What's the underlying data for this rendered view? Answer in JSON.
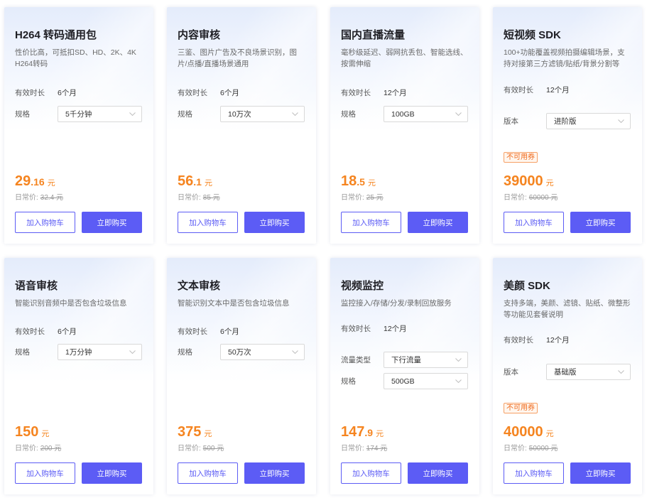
{
  "colors": {
    "accent": "#5c5cf5",
    "price": "#f5841f",
    "badge_text": "#f06a1c",
    "badge_border": "#f6a066"
  },
  "icons": {
    "select_arrow": "chevron-down-icon"
  },
  "products": [
    {
      "title": "H264 转码通用包",
      "desc": [
        "性价比高，可抵扣SD、HD、2K、4K",
        "H264转码"
      ],
      "duration": {
        "label": "有效时长",
        "value": "6个月"
      },
      "options": [
        {
          "label": "规格",
          "value": "5千分钟"
        }
      ],
      "price": {
        "integer": "29",
        "decimal": ".16",
        "unit": "元"
      },
      "regular_price": {
        "label": "日常价:",
        "value": "32.4 元"
      },
      "cart_label": "加入购物车",
      "buy_label": "立即购买"
    },
    {
      "title": "内容审核",
      "desc": [
        "三鉴、图片广告及不良场景识别，图",
        "片/点播/直播场景通用"
      ],
      "duration": {
        "label": "有效时长",
        "value": "6个月"
      },
      "options": [
        {
          "label": "规格",
          "value": "10万次"
        }
      ],
      "price": {
        "integer": "56",
        "decimal": ".1",
        "unit": "元"
      },
      "regular_price": {
        "label": "日常价:",
        "value": "85 元"
      },
      "cart_label": "加入购物车",
      "buy_label": "立即购买"
    },
    {
      "title": "国内直播流量",
      "desc": [
        "毫秒级延迟、弱网抗丢包、智能选线、",
        "按需伸缩"
      ],
      "duration": {
        "label": "有效时长",
        "value": "12个月"
      },
      "options": [
        {
          "label": "规格",
          "value": "100GB"
        }
      ],
      "price": {
        "integer": "18",
        "decimal": ".5",
        "unit": "元"
      },
      "regular_price": {
        "label": "日常价:",
        "value": "25 元"
      },
      "cart_label": "加入购物车",
      "buy_label": "立即购买"
    },
    {
      "title": "短视频 SDK",
      "desc": [
        "100+功能覆盖视频拍摄编辑场景，支",
        "持对接第三方滤镜/贴纸/背景分割等"
      ],
      "duration": {
        "label": "有效时长",
        "value": "12个月"
      },
      "options": [
        {
          "label": "版本",
          "value": "进阶版"
        }
      ],
      "badge": "不可用券",
      "price": {
        "integer": "39000",
        "unit": "元"
      },
      "regular_price": {
        "label": "日常价:",
        "value": "60000 元"
      },
      "cart_label": "加入购物车",
      "buy_label": "立即购买"
    },
    {
      "title": "语音审核",
      "desc": [
        "智能识别音频中是否包含垃圾信息"
      ],
      "duration": {
        "label": "有效时长",
        "value": "6个月"
      },
      "options": [
        {
          "label": "规格",
          "value": "1万分钟"
        }
      ],
      "price": {
        "integer": "150",
        "unit": "元"
      },
      "regular_price": {
        "label": "日常价:",
        "value": "200 元"
      },
      "cart_label": "加入购物车",
      "buy_label": "立即购买"
    },
    {
      "title": "文本审核",
      "desc": [
        "智能识别文本中是否包含垃圾信息"
      ],
      "duration": {
        "label": "有效时长",
        "value": "6个月"
      },
      "options": [
        {
          "label": "规格",
          "value": "50万次"
        }
      ],
      "price": {
        "integer": "375",
        "unit": "元"
      },
      "regular_price": {
        "label": "日常价:",
        "value": "500 元"
      },
      "cart_label": "加入购物车",
      "buy_label": "立即购买"
    },
    {
      "title": "视频监控",
      "desc": [
        "监控接入/存储/分发/录制回放服务"
      ],
      "duration": {
        "label": "有效时长",
        "value": "12个月"
      },
      "options": [
        {
          "label": "流量类型",
          "value": "下行流量"
        },
        {
          "label": "规格",
          "value": "500GB"
        }
      ],
      "price": {
        "integer": "147",
        "decimal": ".9",
        "unit": "元"
      },
      "regular_price": {
        "label": "日常价:",
        "value": "174 元"
      },
      "cart_label": "加入购物车",
      "buy_label": "立即购买"
    },
    {
      "title": "美颜 SDK",
      "desc": [
        "支持多端，美颜、滤镜、贴纸、微整形",
        "等功能见套餐说明"
      ],
      "duration": {
        "label": "有效时长",
        "value": "12个月"
      },
      "options": [
        {
          "label": "版本",
          "value": "基础版"
        }
      ],
      "badge": "不可用券",
      "price": {
        "integer": "40000",
        "unit": "元"
      },
      "regular_price": {
        "label": "日常价:",
        "value": "50000 元"
      },
      "cart_label": "加入购物车",
      "buy_label": "立即购买"
    }
  ]
}
